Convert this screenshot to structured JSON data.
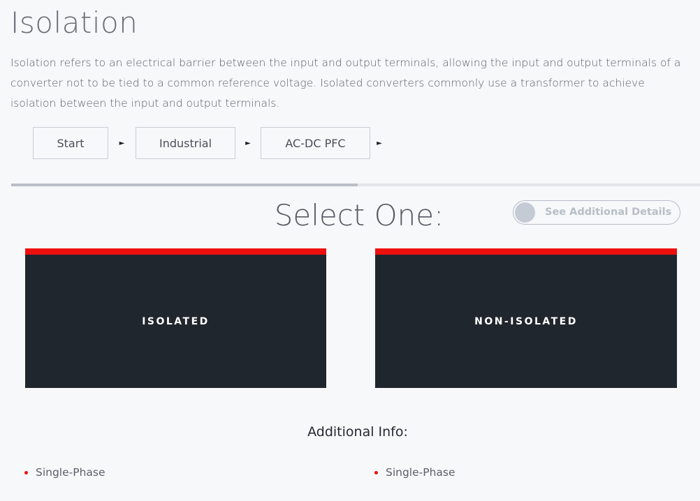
{
  "page": {
    "title": "Isolation",
    "intro": "Isolation refers to an electrical barrier between the input and output terminals, allowing the input and output terminals of a converter not to be tied to a common reference voltage. Isolated converters commonly use a transformer to achieve isolation between the input and output terminals."
  },
  "breadcrumb": {
    "items": [
      {
        "label": "Start"
      },
      {
        "label": "Industrial"
      },
      {
        "label": "AC-DC PFC"
      }
    ],
    "separator_icon": "triangle-right-icon",
    "separator_glyph": "►"
  },
  "progress": {
    "fraction": 0.503
  },
  "selection": {
    "heading": "Select One:",
    "details_toggle": {
      "label": "See Additional Details",
      "state": "off"
    },
    "options": [
      {
        "label": "ISOLATED"
      },
      {
        "label": "NON-ISOLATED"
      }
    ]
  },
  "additional_info": {
    "heading": "Additional Info:",
    "left_items": [
      "Single-Phase"
    ],
    "right_items": [
      "Single-Phase"
    ]
  },
  "colors": {
    "accent_red": "#ee0f0f",
    "card_dark": "#20262e",
    "background": "#f7f8fa"
  }
}
